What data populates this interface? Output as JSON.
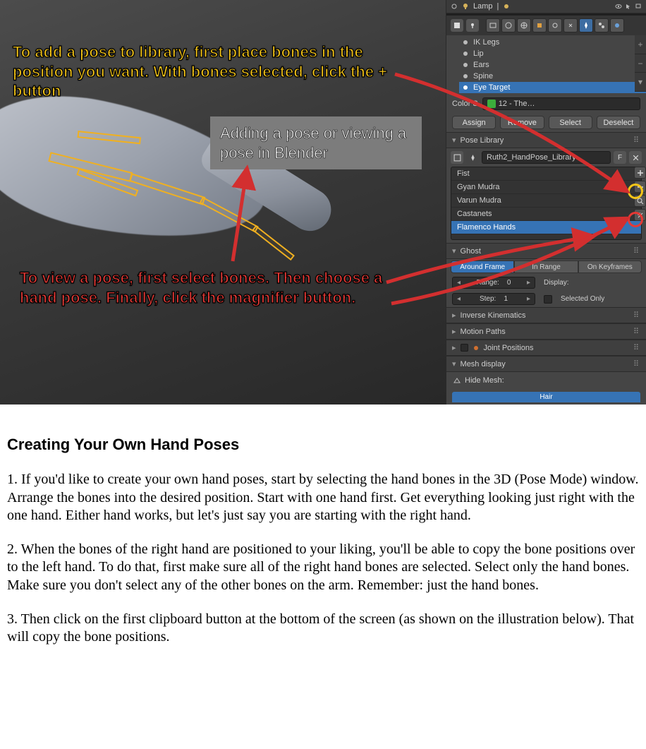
{
  "annotations": {
    "yellow": "To add a pose to library, first place bones in the position you want.  With bones selected, click the + button",
    "caption": "Adding a pose or viewing a pose in Blender",
    "red": "To view a pose, first select bones.  Then choose a hand pose.  Finally, click the magnifier button."
  },
  "outliner": {
    "item": "Lamp",
    "pipe": "|"
  },
  "bone_groups": {
    "items": [
      "IK Legs",
      "Lip",
      "Ears",
      "Spine",
      "Eye Target"
    ],
    "selectedIndex": 4,
    "color_label": "Color S",
    "color_value": "12 - The…",
    "buttons": [
      "Assign",
      "Remove",
      "Select",
      "Deselect"
    ]
  },
  "pose_library": {
    "header": "Pose Library",
    "name": "Ruth2_HandPose_Library",
    "poses": [
      "Fist",
      "Gyan Mudra",
      "Varun Mudra",
      "Castanets",
      "Flamenco Hands"
    ],
    "selectedIndex": 4,
    "side_plus_tip": "+",
    "side_minus_tip": "−"
  },
  "ghost": {
    "header": "Ghost",
    "tabs": [
      "Around Frame",
      "In Range",
      "On Keyframes"
    ],
    "range_label": "Range:",
    "range_value": "0",
    "step_label": "Step:",
    "step_value": "1",
    "display_label": "Display:",
    "sel_only_label": "Selected Only"
  },
  "panels": {
    "ik": "Inverse Kinematics",
    "motion": "Motion Paths",
    "joint": "Joint Positions",
    "mesh": "Mesh display",
    "hide_mesh": "Hide Mesh:",
    "hair": "Hair"
  },
  "doc": {
    "heading": "Creating Your Own Hand Poses",
    "p1": "1. If you'd like to create your own hand poses, start by selecting the hand bones in the 3D (Pose Mode) window.  Arrange the bones into the desired position.  Start with one hand first.  Get everything looking just right with the one hand.  Either hand works, but let's just say you are starting with the right hand.",
    "p2": "2. When the bones of the right hand are positioned to your liking, you'll be able to copy the bone positions over to the left hand.  To do that, first make sure all of the right hand bones are selected.  Select only the hand bones.  Make sure you don't select any of the other bones on the arm.  Remember: just the hand bones.",
    "p3": "3. Then click on the first clipboard button at the bottom of the screen (as shown on the illustration below).  That will copy the bone positions."
  },
  "icons": {
    "lamp": "lamp-icon",
    "eye": "eye-icon",
    "cursor": "cursor-icon",
    "render": "render-icon",
    "bone": "bone-icon",
    "plus": "plus-icon",
    "minus": "minus-icon",
    "magnifier": "magnifier-icon"
  }
}
